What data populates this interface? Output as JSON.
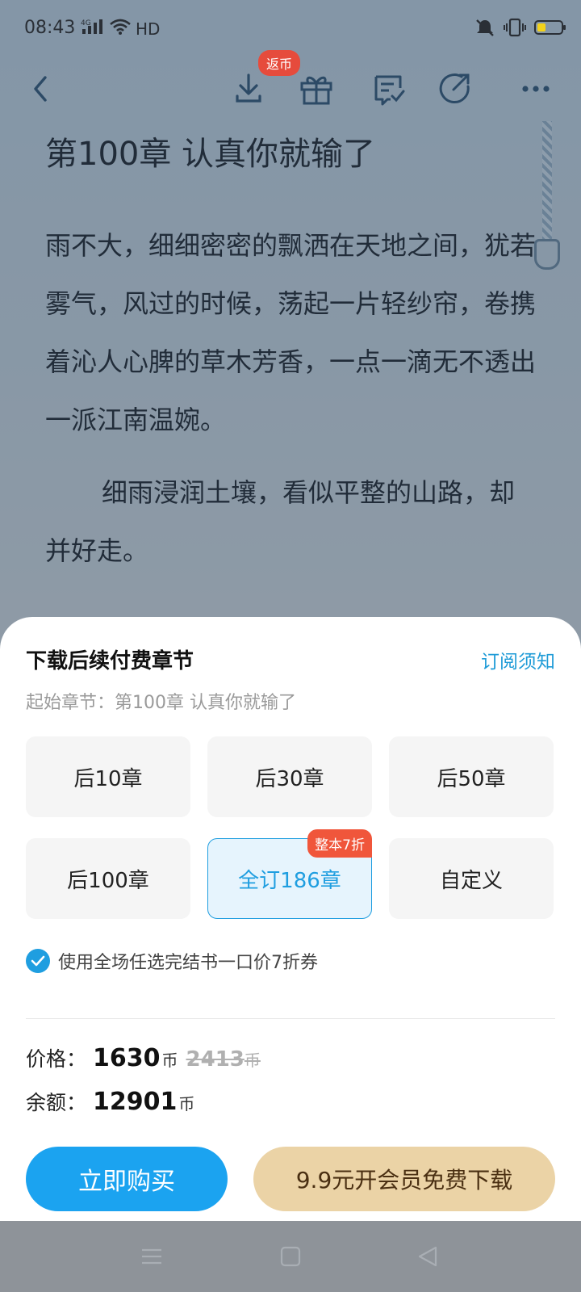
{
  "status_bar": {
    "time": "08:43",
    "network": "4G",
    "hd": "HD",
    "icons": [
      "signal-icon",
      "wifi-icon",
      "mute-icon",
      "vibrate-icon",
      "battery-icon"
    ]
  },
  "toolbar": {
    "back_icon": "back-arrow-icon",
    "download_icon": "download-icon",
    "coin_badge": "返币",
    "gift_icon": "gift-icon",
    "comment_icon": "comment-icon",
    "share_icon": "share-icon",
    "more_icon": "more-dots-icon"
  },
  "reader": {
    "chapter_title": "第100章 认真你就输了",
    "paragraphs": [
      "雨不大，细细密密的飘洒在天地之间，犹若雾气，风过的时候，荡起一片轻纱帘，卷携着沁人心脾的草木芳香，一点一滴无不透出一派江南温婉。",
      "细雨浸润土壤，看似平整的山路，却并好走。"
    ]
  },
  "sheet": {
    "title": "下载后续付费章节",
    "notice_link": "订阅须知",
    "start_chapter": "起始章节：第100章 认真你就输了",
    "options": [
      {
        "label": "后10章",
        "selected": false
      },
      {
        "label": "后30章",
        "selected": false
      },
      {
        "label": "后50章",
        "selected": false
      },
      {
        "label": "后100章",
        "selected": false
      },
      {
        "label": "全订186章",
        "selected": true,
        "badge": "整本7折"
      },
      {
        "label": "自定义",
        "selected": false
      }
    ],
    "coupon_checked": true,
    "coupon_text": "使用全场任选完结书一口价7折券",
    "price_label": "价格：",
    "price_value": "1630",
    "price_unit": "币",
    "original_price": "2413",
    "original_unit": "币",
    "balance_label": "余额：",
    "balance_value": "12901",
    "balance_unit": "币",
    "buy_button": "立即购买",
    "vip_button": "9.9元开会员免费下载"
  },
  "colors": {
    "accent": "#1ba3f0",
    "vip": "#ebd3a6",
    "badge": "#f0563b"
  }
}
